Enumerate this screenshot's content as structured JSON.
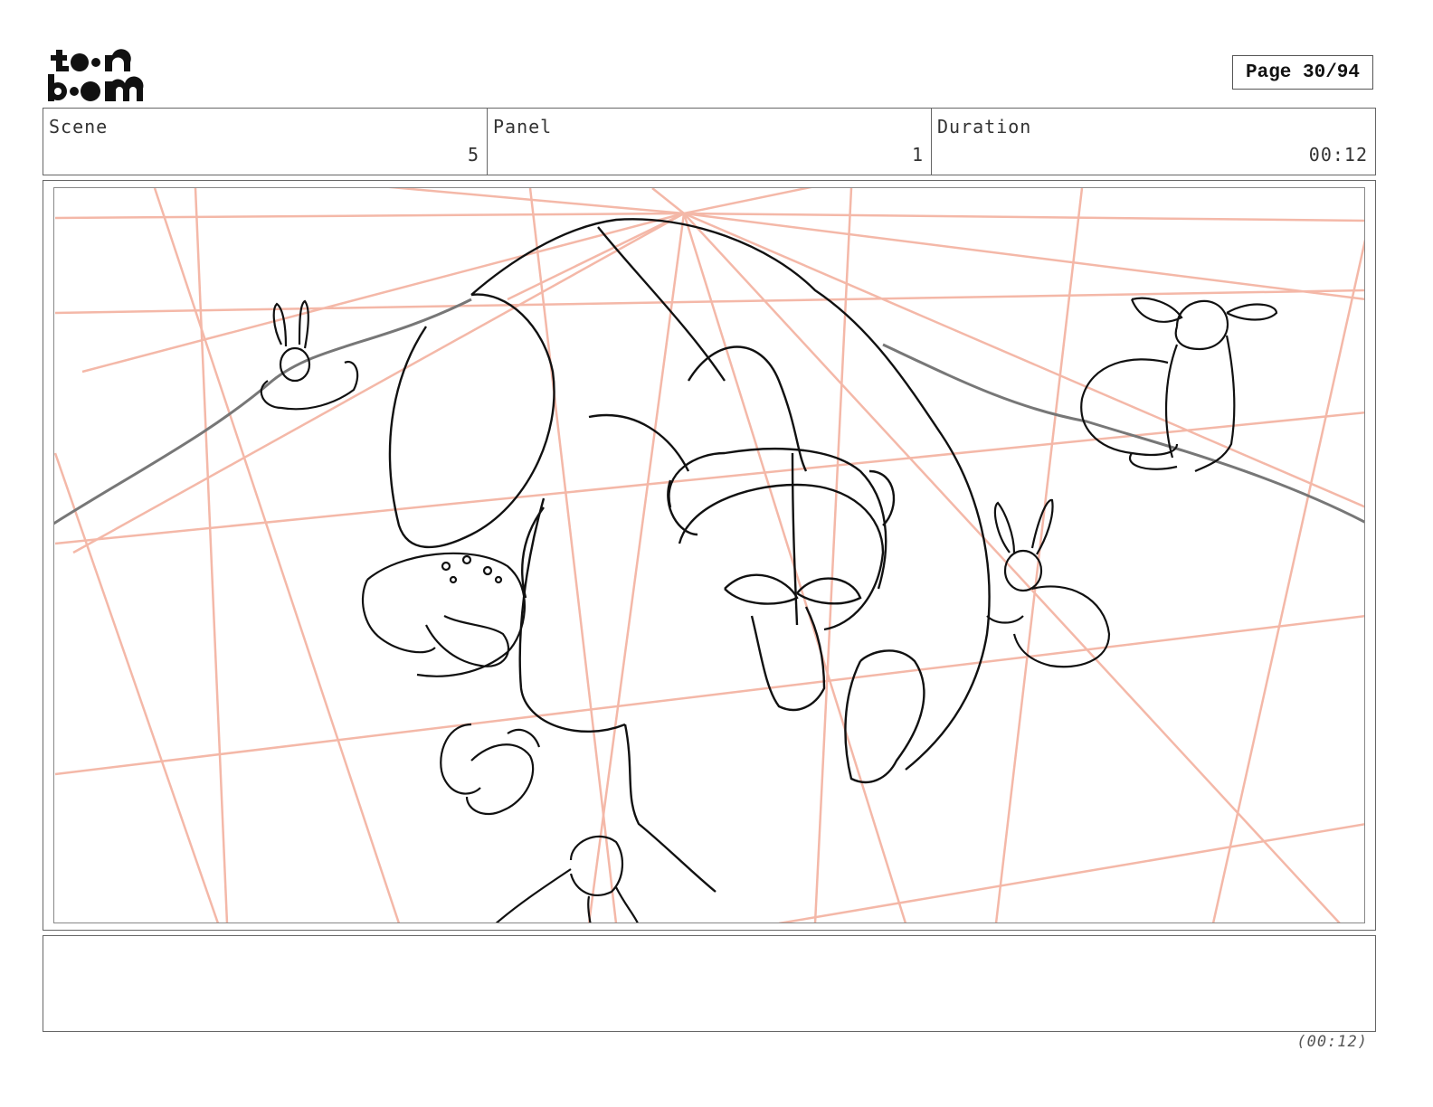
{
  "logo": {
    "line1": "toon",
    "line2": "boom"
  },
  "page": {
    "label": "Page 30/94"
  },
  "header": {
    "scene_label": "Scene",
    "scene_value": "5",
    "panel_label": "Panel",
    "panel_value": "1",
    "duration_label": "Duration",
    "duration_value": "00:12"
  },
  "panel": {
    "description": "",
    "guide_color": "#f4b8a8",
    "sketch_color": "#111111"
  },
  "notes": {
    "text": ""
  },
  "footer": {
    "duration": "(00:12)"
  }
}
